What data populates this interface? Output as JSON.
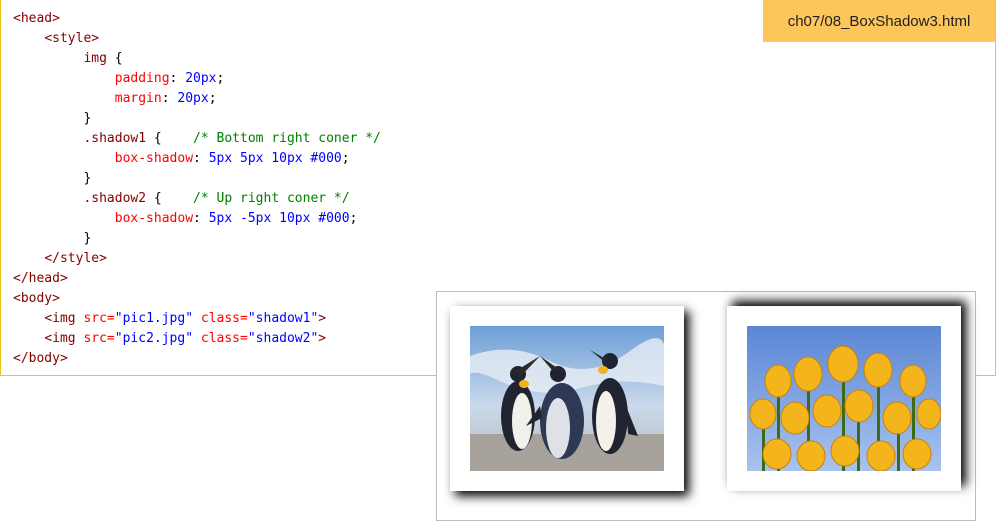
{
  "file_tag": "ch07/08_BoxShadow3.html",
  "code": {
    "line1": "<head>",
    "line2": "<style>",
    "line3_sel": "img",
    "line3_punc": " {",
    "line4_prop": "padding",
    "line4_colon": ": ",
    "line4_val": "20px",
    "line4_end": ";",
    "line5_prop": "margin",
    "line5_colon": ": ",
    "line5_val": "20px",
    "line5_end": ";",
    "line6": "}",
    "line7_sel": ".shadow1",
    "line7_punc": " {    ",
    "line7_com": "/* Bottom right coner */",
    "line8_prop": "box-shadow",
    "line8_colon": ": ",
    "line8_val": "5px 5px 10px #000",
    "line8_end": ";",
    "line9": "}",
    "line10_sel": ".shadow2",
    "line10_punc": " {    ",
    "line10_com": "/* Up right coner */",
    "line11_prop": "box-shadow",
    "line11_colon": ": ",
    "line11_val": "5px -5px 10px #000",
    "line11_end": ";",
    "line12": "}",
    "line13": "</style>",
    "line14": "</head>",
    "line15": "<body>",
    "line16_open": "<img ",
    "line16_attr1": "src=",
    "line16_str1": "\"pic1.jpg\"",
    "line16_attr2": " class=",
    "line16_str2": "\"shadow1\"",
    "line16_close": ">",
    "line17_open": "<img ",
    "line17_attr1": "src=",
    "line17_str1": "\"pic2.jpg\"",
    "line17_attr2": " class=",
    "line17_str2": "\"shadow2\"",
    "line17_close": ">",
    "line18": "</body>"
  },
  "preview": {
    "image1": "penguins-photo",
    "image2": "tulips-photo"
  },
  "colors": {
    "tag": "#800000",
    "property": "#ff0000",
    "value": "#0000ff",
    "comment": "#008000",
    "file_tag_bg": "#fdc65a",
    "panel_border": "#f0c419"
  }
}
